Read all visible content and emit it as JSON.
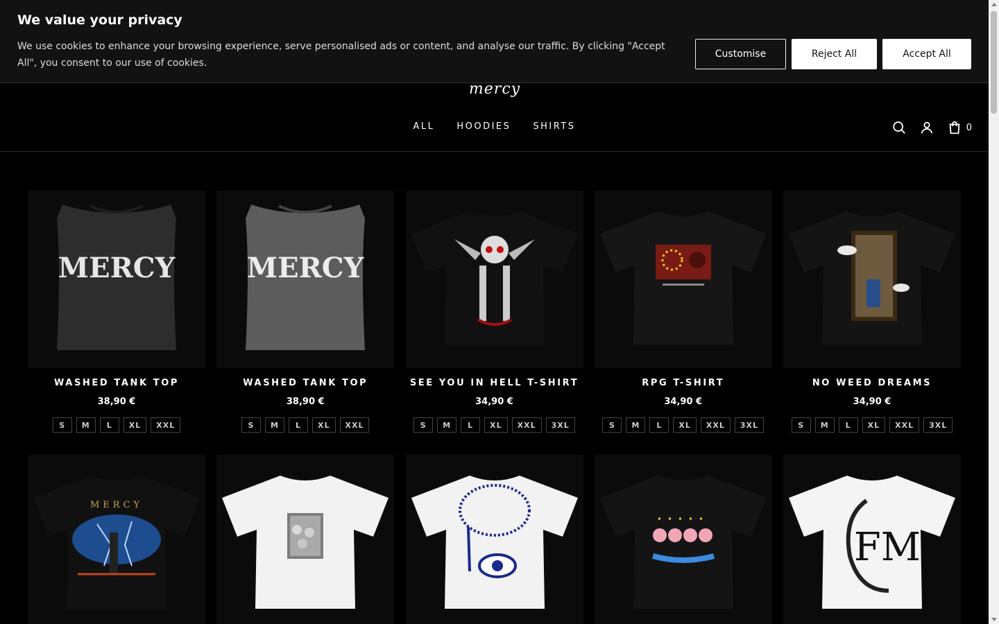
{
  "cookie": {
    "title": "We value your privacy",
    "text": "We use cookies to enhance your browsing experience, serve personalised ads or content, and analyse our traffic. By clicking \"Accept All\", you consent to our use of cookies.",
    "customise": "Customise",
    "reject": "Reject All",
    "accept": "Accept All"
  },
  "header": {
    "logo_text": "mercy",
    "nav": [
      "ALL",
      "HOODIES",
      "SHIRTS"
    ],
    "cart_count": "0",
    "icons": [
      "search-icon",
      "account-icon",
      "cart-icon"
    ]
  },
  "products": [
    {
      "title": "WASHED TANK TOP",
      "price": "38,90 €",
      "sizes": [
        "S",
        "M",
        "L",
        "XL",
        "XXL"
      ],
      "graphic": "tank-dark",
      "print": "MERCY"
    },
    {
      "title": "WASHED TANK TOP",
      "price": "38,90 €",
      "sizes": [
        "S",
        "M",
        "L",
        "XL",
        "XXL"
      ],
      "graphic": "tank-grey",
      "print": "MERCY"
    },
    {
      "title": "SEE YOU IN HELL T-SHIRT",
      "price": "34,90 €",
      "sizes": [
        "S",
        "M",
        "L",
        "XL",
        "XXL",
        "3XL"
      ],
      "graphic": "tee-black-skull"
    },
    {
      "title": "RPG T-SHIRT",
      "price": "34,90 €",
      "sizes": [
        "S",
        "M",
        "L",
        "XL",
        "XXL",
        "3XL"
      ],
      "graphic": "tee-black-rpg"
    },
    {
      "title": "NO WEED DREAMS",
      "price": "34,90 €",
      "sizes": [
        "S",
        "M",
        "L",
        "XL",
        "XXL",
        "3XL"
      ],
      "graphic": "tee-black-painting"
    },
    {
      "graphic": "tee-black-storm",
      "print": "MERCY"
    },
    {
      "graphic": "tee-white-sheep"
    },
    {
      "graphic": "tee-white-rosary"
    },
    {
      "graphic": "tee-black-angels"
    },
    {
      "graphic": "tee-white-fm",
      "print": "FM"
    }
  ]
}
